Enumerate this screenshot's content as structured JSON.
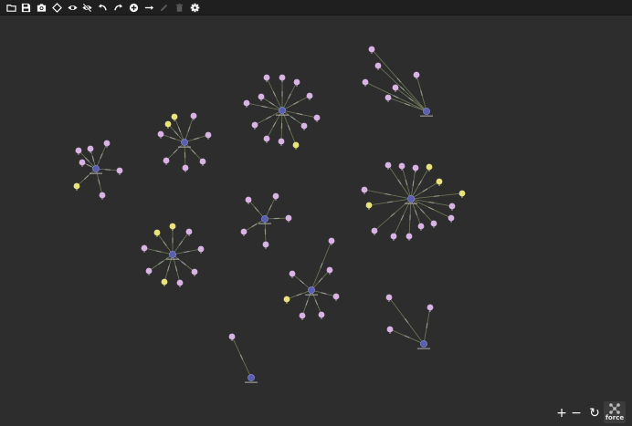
{
  "toolbar": {
    "buttons": [
      {
        "id": "open",
        "icon": "folder-icon"
      },
      {
        "id": "save",
        "icon": "save-icon"
      },
      {
        "id": "screenshot",
        "icon": "camera-icon"
      },
      {
        "id": "select-shape",
        "icon": "diamond-icon"
      },
      {
        "id": "show",
        "icon": "eye-icon"
      },
      {
        "id": "hide",
        "icon": "eye-off-icon"
      },
      {
        "id": "undo",
        "icon": "undo-icon"
      },
      {
        "id": "redo",
        "icon": "redo-icon"
      },
      {
        "id": "add-node",
        "icon": "add-circle-icon"
      },
      {
        "id": "add-edge",
        "icon": "arrow-right-icon"
      },
      {
        "id": "edit",
        "icon": "pencil-icon",
        "disabled": true
      },
      {
        "id": "delete",
        "icon": "trash-icon",
        "disabled": true
      },
      {
        "id": "settings",
        "icon": "gear-icon"
      }
    ]
  },
  "colors": {
    "canvas": "#2d2d2d",
    "toolbar": "#1f1f1f",
    "hub_node": "#5a5fb0",
    "leaf_node": "#d8b4e4",
    "highlight_leaf": "#e9e37e",
    "edge": "#6f7a58"
  },
  "graph": {
    "clusters": [
      {
        "leaves": "pppppppppppy"
      },
      {
        "leaves": "ppppp"
      },
      {
        "leaves": "yppppppy"
      },
      {
        "leaves": "pyppppp"
      },
      {
        "leaves": "pypppppppyyyppp"
      },
      {
        "leaves": "pppppp"
      },
      {
        "leaves": "pyyppppyp"
      },
      {
        "leaves": "pppppyp"
      },
      {
        "leaves": "ppp"
      },
      {
        "leaves": "p"
      }
    ]
  },
  "controls": {
    "zoom_in": "+",
    "zoom_out": "−",
    "reset": "↻",
    "layout_icon": "force-layout-icon",
    "layout_label": "force"
  }
}
